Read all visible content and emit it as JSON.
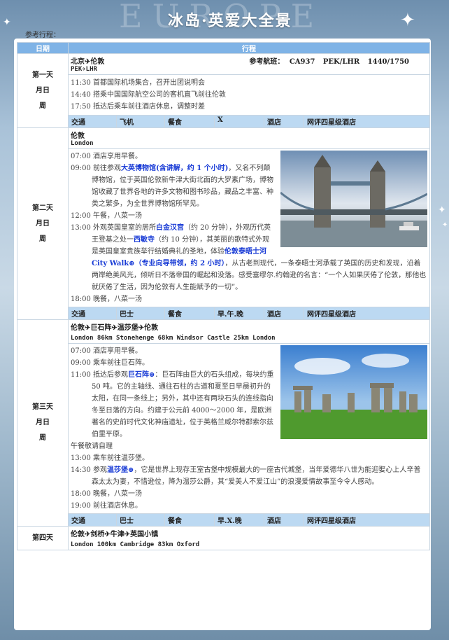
{
  "header": {
    "bg_word": "EUROPE",
    "title": "冰岛·英爱大全景"
  },
  "ref_label": "参考行程：",
  "table": {
    "col_day": "日期",
    "col_route": "行程"
  },
  "days": [
    {
      "day_label": "第一天",
      "month_label": "月日",
      "week_label": "周",
      "route": "北京✈伦敦",
      "flight_label": "参考航班：",
      "flight_no": "CA937",
      "flight_route": "PEK/LHR",
      "flight_time": "1440/1750",
      "route_en": "PEK✈LHR",
      "items": [
        "11:30 首都国际机场集合，召开出团说明会",
        "14:40 搭乘中国国际航空公司的客机直飞前往伦敦",
        "17:50 抵达后乘车前往酒店休息，调整时差"
      ],
      "info": {
        "transport_label": "交通",
        "transport": "飞机",
        "meal_label": "餐食",
        "meal": "X",
        "hotel_label": "酒店",
        "hotel": "网评四星级酒店"
      }
    },
    {
      "day_label": "第二天",
      "month_label": "月日",
      "week_label": "周",
      "route": "伦敦",
      "route_en": "London",
      "items": {
        "i1": "07:00 酒店享用早餐。",
        "i2_pre": "09:00 前往参观",
        "i2_hl": "大英博物馆(含讲解，约 1 个小时)",
        "i2_post": "，又名不列颠博物馆，位于英国伦敦新牛津大街北面的大罗素广场，博物馆收藏了世界各地的许多文物和图书珍品，藏品之丰富、种类之繁多，为全世界博物馆所罕见。",
        "i3": "12:00 午餐，八菜一汤",
        "i4_pre": "13:00 外观英国皇室的居所",
        "i4_hl1": "白金汉宫",
        "i4_mid1": "（约 20 分钟），外观历代英王登基之处一",
        "i4_hl2": "西敏寺",
        "i4_mid2": "（约 10 分钟），其美丽的歌特式外观是英国皇室贵族举行结婚典礼的圣地，体验",
        "i4_hl3": "伦敦泰晤士河 City Walk⊕（专业向导带领，约 2 小时）",
        "i4_post": "，从古老到现代，一条泰晤士河承载了英国的历史和发现，沿着两岸绝美风光，倾听日不落帝国的崛起和没落。感受塞缪尔.约翰逊的名言：“一个人如果厌倦了伦敦，那他也就厌倦了生活，因为伦敦有人生能赋予的一切”。",
        "i5": "18:00 晚餐，八菜一汤"
      },
      "info": {
        "transport_label": "交通",
        "transport": "巴士",
        "meal_label": "餐食",
        "meal": "早.午.晚",
        "hotel_label": "酒店",
        "hotel": "网评四星级酒店"
      }
    },
    {
      "day_label": "第三天",
      "month_label": "月日",
      "week_label": "周",
      "route": "伦敦✈巨石阵✈温莎堡✈伦敦",
      "route_en": "London 86km Stonehenge 68km Windsor Castle 25km London",
      "items": {
        "i1": "07:00 酒店享用早餐。",
        "i2": "09:00 乘车前往巨石阵。",
        "i3_pre": "11:00 抵达后参观",
        "i3_hl": "巨石阵⊕",
        "i3_post": "：巨石阵由巨大的石头组成，每块约重 50 吨。它的主轴线、通往石柱的古道和夏至日早晨初升的太阳，在同一条线上；另外，其中还有两块石头的连线指向冬至日落的方向。约建于公元前 4000～2000 年，是欧洲著名的史前时代文化神庙遗址，位于英格兰威尔特郡索尔兹伯里平原。",
        "i4": "午餐敬请自理",
        "i5": "13:00 乘车前往温莎堡。",
        "i6_pre": "14:30 参观",
        "i6_hl": "温莎堡⊕",
        "i6_post": "，它是世界上现存王室古堡中规模最大的一座古代城堡，当年爱德华八世为能迎娶心上人辛普森太太为妻，不惜逊位，降为温莎公爵，其“爱美人不爱江山”的浪漫爱情故事至今令人感动。",
        "i7": "18:00 晚餐，八菜一汤",
        "i8": "19:00 前往酒店休息。"
      },
      "info": {
        "transport_label": "交通",
        "transport": "巴士",
        "meal_label": "餐食",
        "meal": "早.X.晚",
        "hotel_label": "酒店",
        "hotel": "网评四星级酒店"
      }
    },
    {
      "day_label": "第四天",
      "route": "伦敦✈剑桥✈牛津✈英国小镇",
      "route_en": "London 100km Cambridge 83km Oxford"
    }
  ],
  "colors": {
    "accent": "#7fb3e6",
    "info_bar": "#bcd9f2",
    "highlight": "#1a3cd6"
  }
}
